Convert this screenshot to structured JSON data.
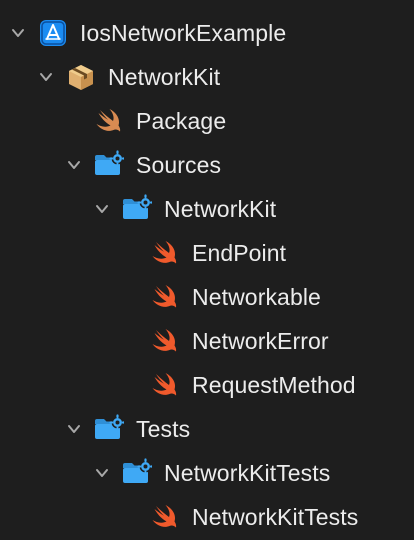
{
  "navigator": {
    "items": [
      {
        "label": "IosNetworkExample",
        "icon": "xcode-project-icon",
        "expanded": true
      },
      {
        "label": "NetworkKit",
        "icon": "package-icon",
        "expanded": true
      },
      {
        "label": "Package",
        "icon": "swift-file-icon",
        "expanded": null
      },
      {
        "label": "Sources",
        "icon": "folder-icon",
        "expanded": true
      },
      {
        "label": "NetworkKit",
        "icon": "folder-icon",
        "expanded": true
      },
      {
        "label": "EndPoint",
        "icon": "swift-file-icon",
        "expanded": null
      },
      {
        "label": "Networkable",
        "icon": "swift-file-icon",
        "expanded": null
      },
      {
        "label": "NetworkError",
        "icon": "swift-file-icon",
        "expanded": null
      },
      {
        "label": "RequestMethod",
        "icon": "swift-file-icon",
        "expanded": null
      },
      {
        "label": "Tests",
        "icon": "folder-icon",
        "expanded": true
      },
      {
        "label": "NetworkKitTests",
        "icon": "folder-icon",
        "expanded": true
      },
      {
        "label": "NetworkKitTests",
        "icon": "swift-file-icon",
        "expanded": null
      }
    ]
  },
  "colors": {
    "background": "#1e1e1e",
    "text": "#ececec",
    "chevron": "#a8a8a8",
    "swift_orange": "#f05a2c",
    "swift_package": "#d98b52",
    "folder_blue": "#3fa9f5",
    "xcode_blue": "#1b8cf2",
    "package_tan": "#e0b070"
  }
}
